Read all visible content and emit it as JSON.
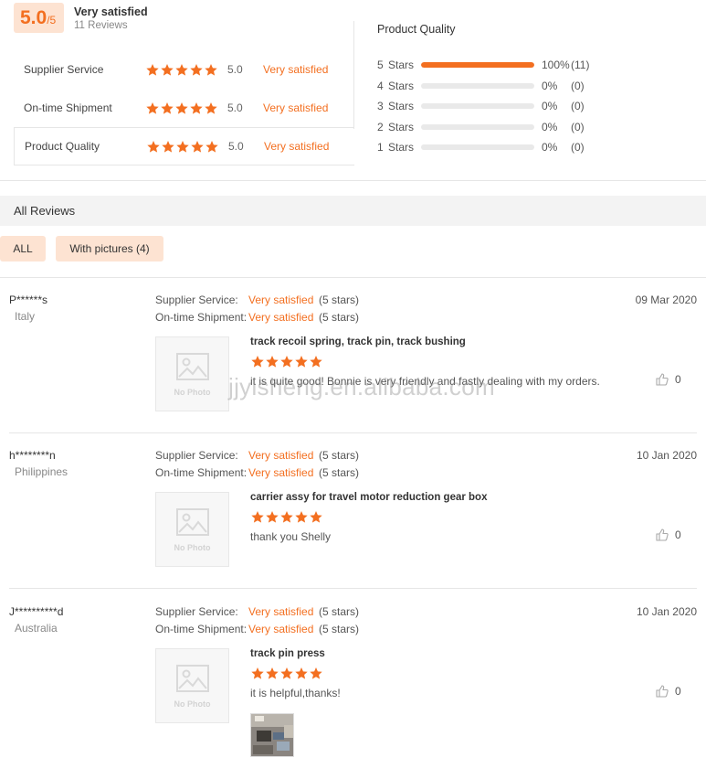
{
  "summary": {
    "score": "5.0",
    "score_max": "/5",
    "title": "Very satisfied",
    "reviews_count": "11 Reviews",
    "ratings": [
      {
        "label": "Supplier Service",
        "value": "5.0",
        "text": "Very satisfied",
        "stars": 5
      },
      {
        "label": "On-time Shipment",
        "value": "5.0",
        "text": "Very satisfied",
        "stars": 5
      },
      {
        "label": "Product Quality",
        "value": "5.0",
        "text": "Very satisfied",
        "stars": 5
      }
    ]
  },
  "quality": {
    "title": "Product Quality",
    "bars": [
      {
        "n": "5",
        "stars_word": "Stars",
        "percent_label": "100%",
        "count": "(11)",
        "fraction": 1.0
      },
      {
        "n": "4",
        "stars_word": "Stars",
        "percent_label": "0%",
        "count": "(0)",
        "fraction": 0
      },
      {
        "n": "3",
        "stars_word": "Stars",
        "percent_label": "0%",
        "count": "(0)",
        "fraction": 0
      },
      {
        "n": "2",
        "stars_word": "Stars",
        "percent_label": "0%",
        "count": "(0)",
        "fraction": 0
      },
      {
        "n": "1",
        "stars_word": "Stars",
        "percent_label": "0%",
        "count": "(0)",
        "fraction": 0
      }
    ]
  },
  "all_reviews": {
    "title": "All Reviews",
    "filters": {
      "all": "ALL",
      "with_pictures": "With pictures (4)"
    }
  },
  "reviews": [
    {
      "user": "P******s",
      "country": "Italy",
      "date": "09 Mar 2020",
      "supplier_label": "Supplier Service:",
      "supplier_value": "Very satisfied",
      "supplier_stars": "(5 stars)",
      "shipment_label": "On-time Shipment:",
      "shipment_value": "Very satisfied",
      "shipment_stars": "(5 stars)",
      "product": "track recoil spring, track pin, track bushing",
      "text": "it is quite good! Bonnie is very friendly and fastly dealing with my orders.",
      "likes": "0",
      "no_photo": "No Photo"
    },
    {
      "user": "h********n",
      "country": "Philippines",
      "date": "10 Jan 2020",
      "supplier_label": "Supplier Service:",
      "supplier_value": "Very satisfied",
      "supplier_stars": "(5 stars)",
      "shipment_label": "On-time Shipment:",
      "shipment_value": "Very satisfied",
      "shipment_stars": "(5 stars)",
      "product": "carrier assy for travel motor reduction gear box",
      "text": "thank you Shelly",
      "likes": "0",
      "no_photo": "No Photo"
    },
    {
      "user": "J**********d",
      "country": "Australia",
      "date": "10 Jan 2020",
      "supplier_label": "Supplier Service:",
      "supplier_value": "Very satisfied",
      "supplier_stars": "(5 stars)",
      "shipment_label": "On-time Shipment:",
      "shipment_value": "Very satisfied",
      "shipment_stars": "(5 stars)",
      "product": "track pin press",
      "text": "it is helpful,thanks!",
      "likes": "0",
      "no_photo": "No Photo"
    }
  ],
  "watermark": "jjyisheng.en.alibaba.com",
  "colors": {
    "accent": "#f36f20",
    "badge_bg": "#fde3d2",
    "header_bg": "#f3f3f3"
  },
  "icons": {
    "star": "star-icon",
    "like": "thumbs-up-icon",
    "no_photo": "image-placeholder-icon"
  }
}
